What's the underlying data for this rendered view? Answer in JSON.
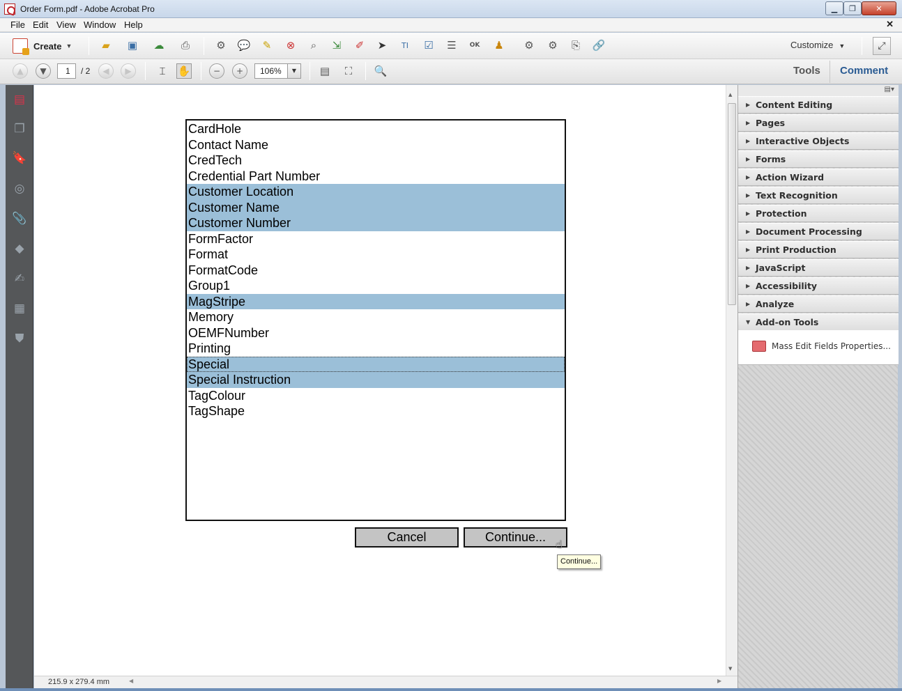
{
  "window": {
    "title": "Order Form.pdf - Adobe Acrobat Pro",
    "min_glyph": "▁",
    "max_glyph": "❐",
    "close_glyph": "✕"
  },
  "menubar": {
    "items": [
      "File",
      "Edit",
      "View",
      "Window",
      "Help"
    ],
    "close_glyph": "✕"
  },
  "toolbar": {
    "create_label": "Create",
    "customize_label": "Customize",
    "dropdown_glyph": "▼"
  },
  "navbar": {
    "page_current": "1",
    "page_total": "/ 2",
    "zoom": "106%"
  },
  "pane_tabs": {
    "tools": "Tools",
    "comment": "Comment"
  },
  "listbox": {
    "items": [
      "CardHole",
      "Contact Name",
      "CredTech",
      "Credential Part Number",
      "Customer Location",
      "Customer Name",
      "Customer Number",
      "FormFactor",
      "Format",
      "FormatCode",
      "Group1",
      "MagStripe",
      "Memory",
      "OEMFNumber",
      "Printing",
      "Special",
      "Special Instruction",
      "TagColour",
      "TagShape"
    ],
    "selected_items": [
      "Customer Location",
      "Customer Name",
      "Customer Number",
      "MagStripe",
      "Special",
      "Special Instruction"
    ],
    "focused_item": "Special",
    "selection_color": "#9bbfd8"
  },
  "dialog": {
    "cancel_label": "Cancel",
    "continue_label": "Continue...",
    "tooltip": "Continue..."
  },
  "status": {
    "page_size": "215.9 x 279.4 mm"
  },
  "right_pane": {
    "panels": [
      "Content Editing",
      "Pages",
      "Interactive Objects",
      "Forms",
      "Action Wizard",
      "Text Recognition",
      "Protection",
      "Document Processing",
      "Print Production",
      "JavaScript",
      "Accessibility",
      "Analyze",
      "Add-on Tools"
    ],
    "expanded_panel": "Add-on Tools",
    "addon_tool": "Mass Edit Fields Properties..."
  },
  "colors": {
    "accent_tab": "#2a5b93",
    "left_nav": "#555759"
  }
}
